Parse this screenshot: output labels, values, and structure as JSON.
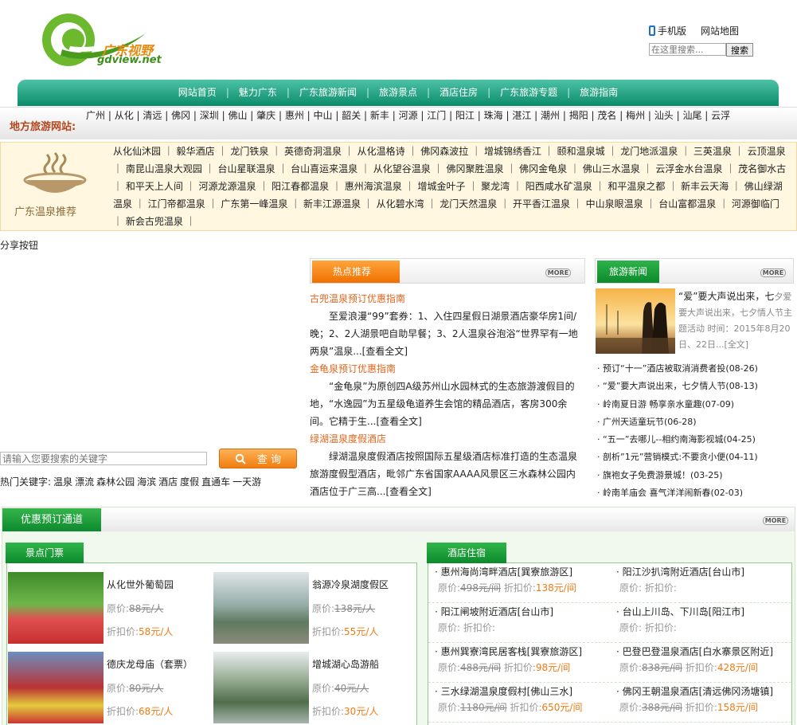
{
  "header": {
    "logo_cn": "广东视野",
    "logo_en": "gdview.net",
    "mobile_label": "手机版",
    "sitemap_label": "网站地图",
    "search_placeholder": "在这里搜索...",
    "search_button": "搜索"
  },
  "nav": [
    "网站首页",
    "魅力广东",
    "广东旅游新闻",
    "旅游景点",
    "酒店住房",
    "广东旅游专题",
    "旅游指南"
  ],
  "local": {
    "label": "地方旅游网站:",
    "links": [
      "广州",
      "从化",
      "清远",
      "佛冈",
      "深圳",
      "佛山",
      "肇庆",
      "惠州",
      "中山",
      "韶关",
      "新丰",
      "河源",
      "江门",
      "阳江",
      "珠海",
      "湛江",
      "潮州",
      "揭阳",
      "茂名",
      "梅州",
      "汕头",
      "汕尾",
      "云浮"
    ]
  },
  "spring": {
    "title": "广东温泉推荐",
    "links": [
      "从化仙沐园",
      "毅华酒店",
      "龙门铁泉",
      "英德奇洞温泉",
      "从化温格诗",
      "佛冈森波拉",
      "增城锦绣香江",
      "颐和温泉城",
      "龙门地派温泉",
      "三英温泉",
      "云顶温泉",
      "南昆山温泉大观园",
      "台山星联温泉",
      "台山喜运来温泉",
      "从化望谷温泉",
      "佛冈聚胜温泉",
      "佛冈金龟泉",
      "佛山三水温泉",
      "云浮金水台温泉",
      "茂名御水古",
      "和平天上人间",
      "河源龙源温泉",
      "阳江春都温泉",
      "惠州海滨温泉",
      "增城金叶子",
      "聚龙湾",
      "阳西咸水矿温泉",
      "和平温泉之都",
      "新丰云天海",
      "佛山绿湖温泉",
      "江门帝都温泉",
      "广东第一峰温泉",
      "新丰江源温泉",
      "从化碧水湾",
      "龙门天然温泉",
      "开平香江温泉",
      "中山泉眼温泉",
      "台山富都温泉",
      "河源御临门",
      "新会古兜温泉"
    ]
  },
  "share_label": "分享按钮",
  "search2": {
    "placeholder": "请输入您要搜索的关键字",
    "button": "查 询",
    "hot_label": "热门关键字:",
    "words": [
      "温泉",
      "漂流",
      "森林公园",
      "海滨",
      "酒店",
      "度假",
      "直通车",
      "一天游"
    ]
  },
  "hot": {
    "tab": "热点推荐",
    "more": "MORE",
    "items": [
      {
        "title": "古兜温泉预订优惠指南",
        "desc": "至爱浪漫“99”套券：1、入住四星假日湖景酒店豪华房1间/晚；2、2人湖景吧自助早餐；3、2人温泉谷泡浴“世界罕有一地两泉”温泉...[查看全文]"
      },
      {
        "title": "金龟泉预订优惠指南",
        "desc": "“金龟泉”为原创四A级苏州山水园林式的生态旅游渡假目的地，“水逸园”为五星级龟道养生会馆的精品酒店，客房300余间。它精于生...[查看全文]"
      },
      {
        "title": "绿湖温泉度假酒店",
        "desc": "绿湖温泉度假酒店按照国际五星级酒店标准打造的生态温泉旅游度假型酒店，毗邻广东省国家AAAA风景区三水森林公园内 酒店位于广三高...[查看全文]"
      }
    ]
  },
  "news": {
    "tab": "旅游新闻",
    "more": "MORE",
    "feature_title": "“爱”要大声说出来，七",
    "feature_desc": "夕爱要大声说出来，七夕情人节主题活动 时间：2015年8月20日、22日...[全文]",
    "items": [
      "预订“十一”酒店被取消消费者投(08-26)",
      "“爱”要大声说出来，七夕情人节(08-13)",
      "岭南夏日游 畅享亲水童趣(07-09)",
      "广州天适童玩节(06-28)",
      "“五一”去哪儿--相约南海影视城(04-25)",
      "剖析”1元”营销模式:不要贪小便(04-11)",
      "旗袍女子免费游景城！(03-25)",
      "岭南羊庙会 喜气洋洋闹新春(02-03)"
    ]
  },
  "promo": {
    "tab": "优惠预订通道",
    "more": "MORE",
    "orig_label": "原价:",
    "disc_label": "折扣价:",
    "spots_tab": "景点门票",
    "spots": [
      {
        "name": "从化世外葡萄园",
        "orig": "88元/人",
        "disc": "58元/人"
      },
      {
        "name": "翁源冷泉湖度假区",
        "orig": "138元/人",
        "disc": "55元/人"
      },
      {
        "name": "德庆龙母庙（套票）",
        "orig": "80元/人",
        "disc": "68元/人"
      },
      {
        "name": "增城湖心岛游船",
        "orig": "40元/人",
        "disc": "30元/人"
      }
    ],
    "hotel_tab": "酒店住宿",
    "hotels": [
      {
        "name": "惠州海尚湾畔酒店[巽寮旅游区]",
        "orig": "498元/间",
        "disc": "138元/间"
      },
      {
        "name": "阳江沙扒湾附近酒店[台山市]",
        "orig": "",
        "disc": ""
      },
      {
        "name": "阳江闸坡附近酒店[台山市]",
        "orig": "",
        "disc": ""
      },
      {
        "name": "台山上川岛、下川岛[阳江市]",
        "orig": "",
        "disc": ""
      },
      {
        "name": "惠州巽寮湾民居客栈[巽寮旅游区]",
        "orig": "488元/间",
        "disc": "98元/间"
      },
      {
        "name": "巴登巴登温泉酒店[白水寨景区附近]",
        "orig": "838元/间",
        "disc": "428元/间"
      },
      {
        "name": "三水绿湖温泉度假村[佛山三水]",
        "orig": "1180元/间",
        "disc": "650元/间"
      },
      {
        "name": "佛冈王朝温泉酒店[清远佛冈汤塘镇]",
        "orig": "388元/间",
        "disc": "158元/间"
      }
    ]
  },
  "colors": {
    "brand_green": "#0b8c6a",
    "accent_orange": "#f07a12"
  }
}
